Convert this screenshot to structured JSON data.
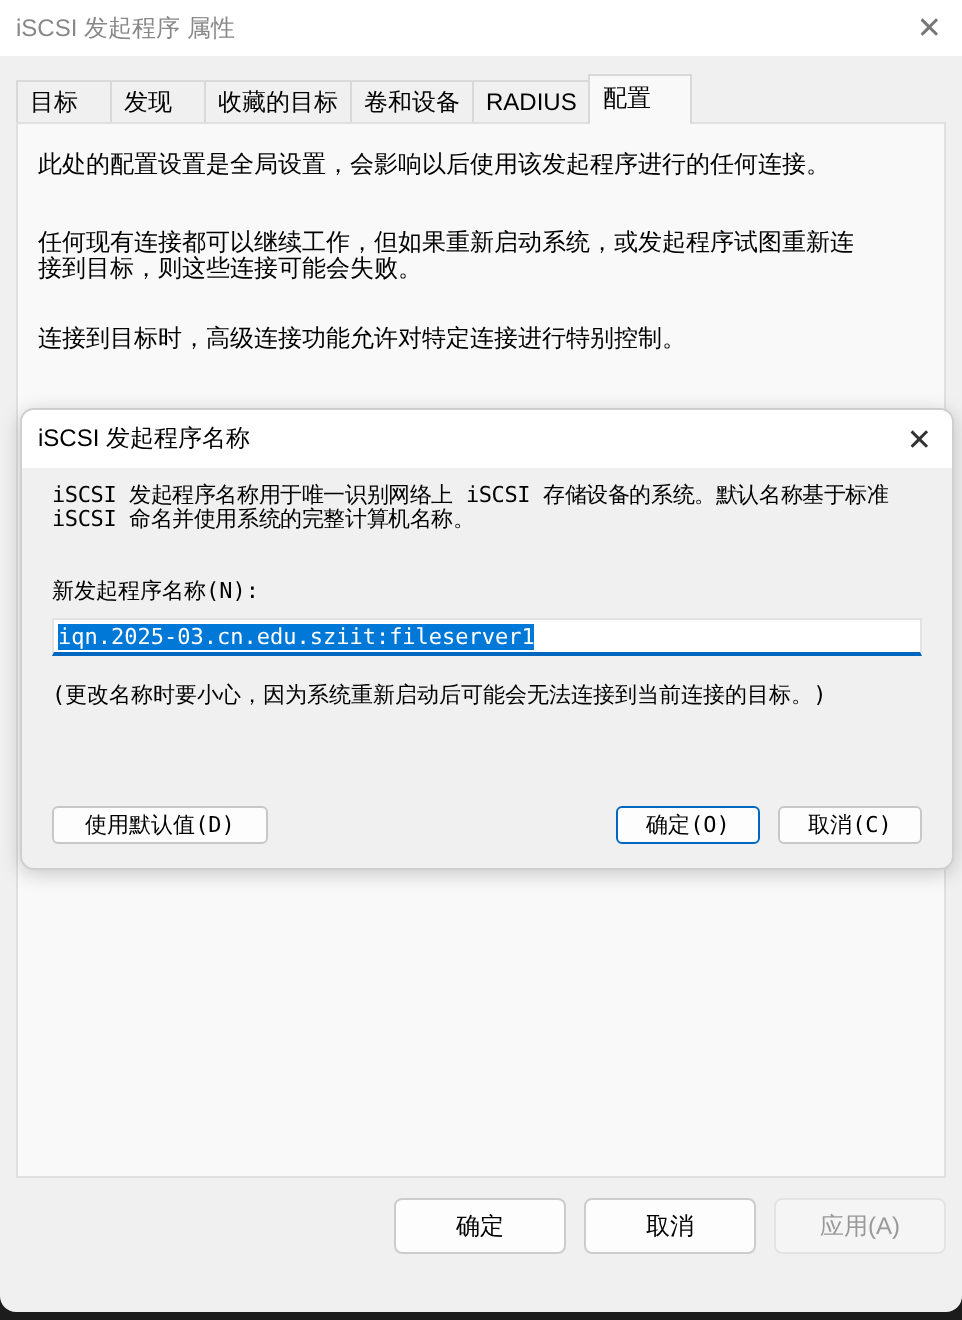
{
  "window": {
    "title": "iSCSI 发起程序 属性",
    "close": "✕"
  },
  "tabs": [
    {
      "label": "目标",
      "selected": false
    },
    {
      "label": "发现",
      "selected": false
    },
    {
      "label": "收藏的目标",
      "selected": false
    },
    {
      "label": "卷和设备",
      "selected": false
    },
    {
      "label": "RADIUS",
      "selected": false
    },
    {
      "label": "配置",
      "selected": true
    }
  ],
  "panel": {
    "paragraphs": [
      "此处的配置设置是全局设置，会影响以后使用该发起程序进行的任何连接。",
      "任何现有连接都可以继续工作，但如果重新启动系统，或发起程序试图重新连接到目标，则这些连接可能会失败。",
      "连接到目标时，高级连接功能允许对特定连接进行特别控制。"
    ]
  },
  "buttons": [
    {
      "label": "确定",
      "disabled": false
    },
    {
      "label": "取消",
      "disabled": false
    },
    {
      "label": "应用(A)",
      "disabled": true
    }
  ],
  "dialog": {
    "title": "iSCSI 发起程序名称",
    "close": "✕",
    "description": "iSCSI 发起程序名称用于唯一识别网络上 iSCSI 存储设备的系统。默认名称基于标准 iSCSI 命名并使用系统的完整计算机名称。",
    "field_label": "新发起程序名称(N):",
    "field": {
      "value": "iqn.2025-03.cn.edu.sziit:fileserver1",
      "selected": true
    },
    "note": "(更改名称时要小心，因为系统重新启动后可能会无法连接到当前连接的目标。)",
    "buttons": [
      {
        "label": "使用默认值(D)",
        "default": false
      },
      {
        "label": "确定(O)",
        "default": true
      },
      {
        "label": "取消(C)",
        "default": false
      }
    ]
  }
}
